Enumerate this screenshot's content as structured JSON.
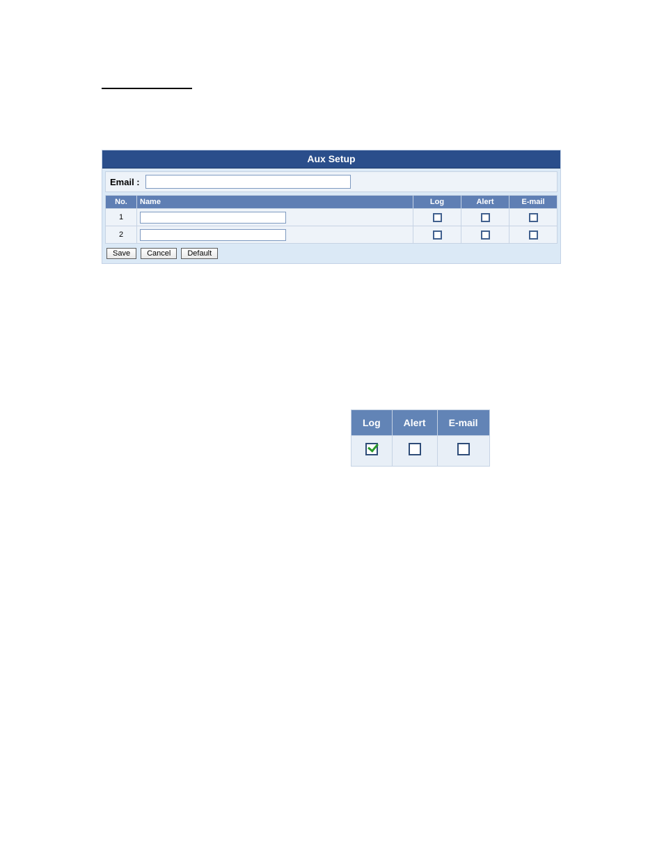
{
  "aux_panel": {
    "title": "Aux Setup",
    "email_label": "Email :",
    "email_value": "",
    "headers": {
      "no": "No.",
      "name": "Name",
      "log": "Log",
      "alert": "Alert",
      "email": "E-mail"
    },
    "rows": [
      {
        "no": "1",
        "name": "",
        "log": false,
        "alert": false,
        "email": false
      },
      {
        "no": "2",
        "name": "",
        "log": false,
        "alert": false,
        "email": false
      }
    ],
    "buttons": {
      "save": "Save",
      "cancel": "Cancel",
      "default": "Default"
    }
  },
  "mini_panel": {
    "headers": {
      "log": "Log",
      "alert": "Alert",
      "email": "E-mail"
    },
    "row": {
      "log": true,
      "alert": false,
      "email": false
    }
  }
}
